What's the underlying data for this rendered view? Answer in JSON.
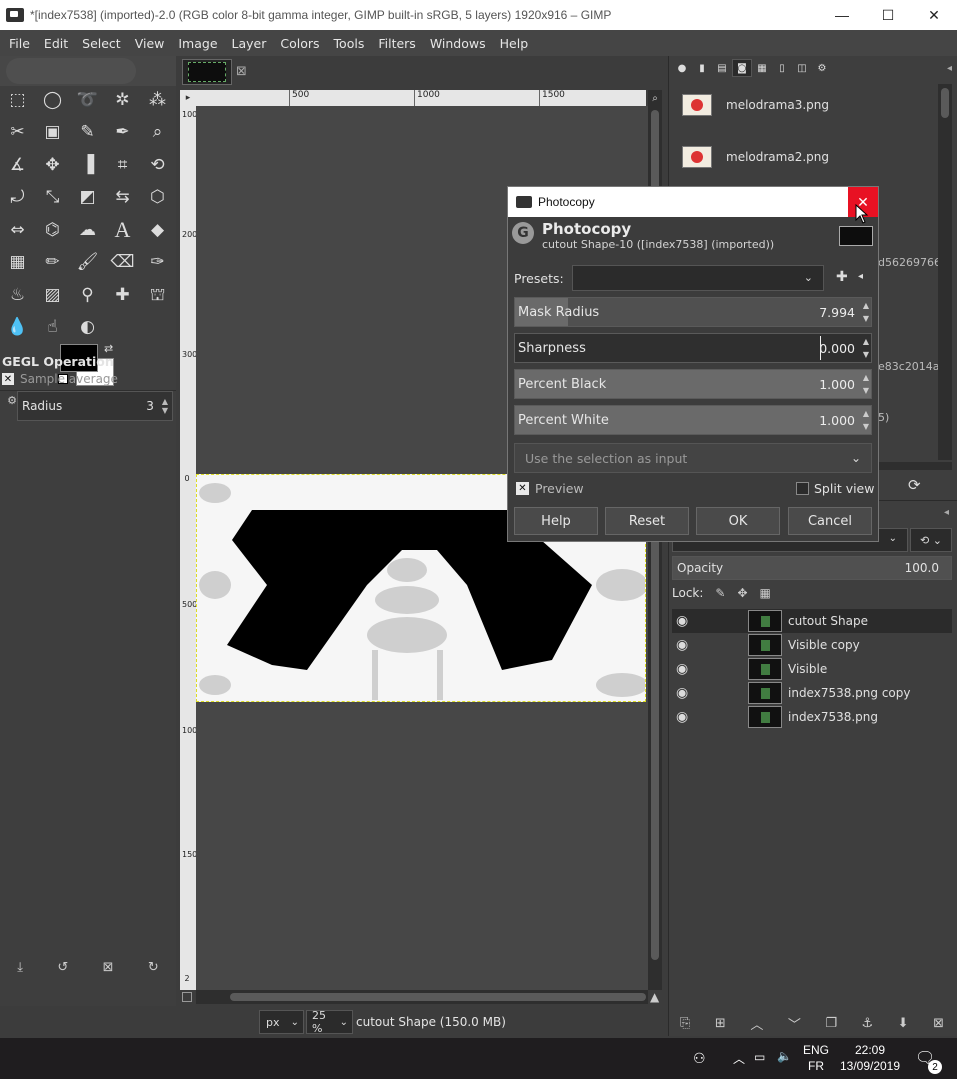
{
  "window": {
    "title": "*[index7538] (imported)-2.0 (RGB color 8-bit gamma integer, GIMP built-in sRGB, 5 layers) 1920x916 – GIMP",
    "minimize": "—",
    "maximize": "☐",
    "close": "✕"
  },
  "menubar": [
    "File",
    "Edit",
    "Select",
    "View",
    "Image",
    "Layer",
    "Colors",
    "Tools",
    "Filters",
    "Windows",
    "Help"
  ],
  "tool_options": {
    "title": "GEGL Operation",
    "sample_average": "Sample average",
    "radius_label": "Radius",
    "radius_value": "3"
  },
  "rulers": {
    "h_ticks": [
      "500",
      "1000",
      "1500"
    ],
    "v_ticks": [
      "100",
      "200",
      "300",
      "0",
      "500",
      "1000",
      "1500",
      "2"
    ]
  },
  "status": {
    "unit": "px",
    "zoom": "25 %",
    "text": "cutout Shape (150.0 MB)"
  },
  "images_panel": {
    "items": [
      "melodrama3.png",
      "melodrama2.png"
    ],
    "partial_texts": [
      "d56269766",
      "e83c2014a",
      "5)"
    ]
  },
  "layers_panel": {
    "opacity_label": "Opacity",
    "opacity_value": "100.0",
    "lock_label": "Lock:",
    "layers": [
      "cutout Shape",
      "Visible copy",
      "Visible",
      "index7538.png copy",
      "index7538.png"
    ]
  },
  "dialog": {
    "window_title": "Photocopy",
    "heading": "Photocopy",
    "subheading": "cutout Shape-10 ([index7538] (imported))",
    "presets_label": "Presets:",
    "sliders": [
      {
        "label": "Mask Radius",
        "value": "7.994",
        "fraction": 0.15
      },
      {
        "label": "Sharpness",
        "value": "0.000",
        "fraction": 0.0
      },
      {
        "label": "Percent Black",
        "value": "1.000",
        "fraction": 1.0
      },
      {
        "label": "Percent White",
        "value": "1.000",
        "fraction": 1.0
      }
    ],
    "selection_input": "Use the selection as input",
    "preview_label": "Preview",
    "split_view_label": "Split view",
    "buttons": {
      "help": "Help",
      "reset": "Reset",
      "ok": "OK",
      "cancel": "Cancel"
    }
  },
  "taskbar": {
    "lang_top": "ENG",
    "lang_bottom": "FR",
    "time": "22:09",
    "date": "13/09/2019",
    "notifications": "2"
  }
}
